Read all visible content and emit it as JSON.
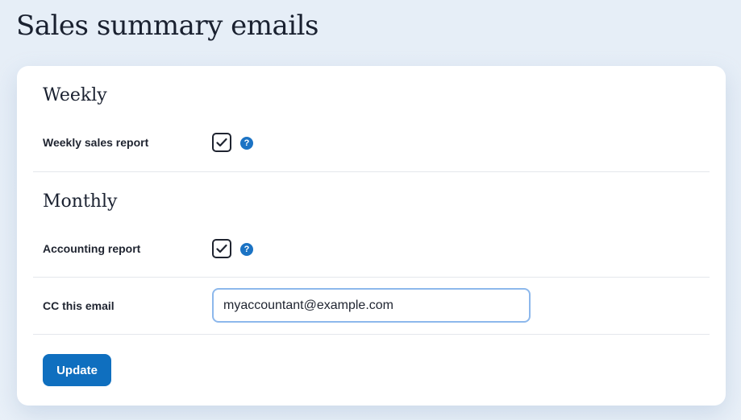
{
  "page": {
    "title": "Sales summary emails"
  },
  "weekly": {
    "heading": "Weekly",
    "weekly_sales_report": {
      "label": "Weekly sales report",
      "checked": true,
      "help_glyph": "?"
    }
  },
  "monthly": {
    "heading": "Monthly",
    "accounting_report": {
      "label": "Accounting report",
      "checked": true,
      "help_glyph": "?"
    },
    "cc_email": {
      "label": "CC this email",
      "value": "myaccountant@example.com"
    }
  },
  "actions": {
    "update_label": "Update"
  },
  "colors": {
    "accent": "#0f6fbf",
    "help_icon": "#1b73c4",
    "input_focus_border": "#8db8ec",
    "background": "#e6eef7"
  },
  "icons": {
    "checkbox_check": "check-icon",
    "help": "help-icon"
  }
}
